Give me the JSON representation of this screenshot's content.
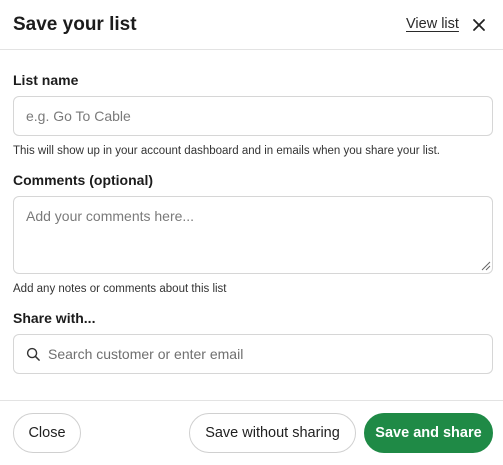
{
  "header": {
    "title": "Save your list",
    "view_list_label": "View list",
    "close_icon": "close-icon"
  },
  "list_name": {
    "label": "List name",
    "placeholder": "e.g. Go To Cable",
    "value": "",
    "helper": "This will show up in your account dashboard and in emails when you share your list."
  },
  "comments": {
    "label": "Comments (optional)",
    "placeholder": "Add your comments here...",
    "value": "",
    "helper": "Add any notes or comments about this list"
  },
  "share": {
    "label": "Share with...",
    "placeholder": "Search customer or enter email",
    "value": "",
    "icon": "search-icon"
  },
  "footer": {
    "close_label": "Close",
    "save_without_sharing_label": "Save without sharing",
    "save_and_share_label": "Save and share"
  },
  "colors": {
    "primary_button": "#1f8a46",
    "border": "#d6d6d6"
  }
}
